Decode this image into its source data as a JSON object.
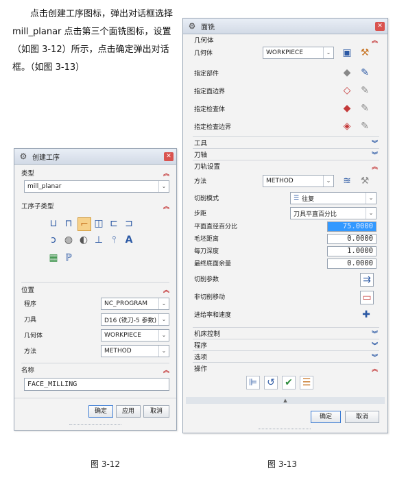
{
  "paragraph": "点击创建工序图标，弹出对话框选择 mill_planar 点击第三个面铣图标，设置（如图 3-12）所示，点击确定弹出对话框。（如图 3-13）",
  "fig12": {
    "caption": "图 3-12",
    "title": "创建工序",
    "type_section": "类型",
    "type_value": "mill_planar",
    "subtype_section": "工序子类型",
    "location_section": "位置",
    "program_label": "程序",
    "program_value": "NC_PROGRAM",
    "tool_label": "刀具",
    "tool_value": "D16 (铣刀-5 参数)",
    "geometry_label": "几何体",
    "geometry_value": "WORKPIECE",
    "method_label": "方法",
    "method_value": "METHOD",
    "name_section": "名称",
    "name_value": "FACE_MILLING",
    "ok": "确定",
    "apply": "应用",
    "cancel": "取消"
  },
  "fig13": {
    "caption": "图 3-13",
    "title": "面铣",
    "geometry_section": "几何体",
    "geometry_label": "几何体",
    "geometry_value": "WORKPIECE",
    "spec_part": "指定部件",
    "spec_face": "指定面边界",
    "spec_check": "指定检查体",
    "spec_check_boundary": "指定检查边界",
    "tool_section": "工具",
    "axis_section": "刀轴",
    "path_section": "刀轨设置",
    "method_label": "方法",
    "method_value": "METHOD",
    "cut_pattern_label": "切削模式",
    "cut_pattern_value": "往复",
    "stepover_label": "步距",
    "stepover_value": "刀具平直百分比",
    "flat_pct_label": "平面直径百分比",
    "flat_pct_value": "75.0000",
    "blank_dist_label": "毛坯距离",
    "blank_dist_value": "0.0000",
    "depth_label": "每刀深度",
    "depth_value": "1.0000",
    "floor_stock_label": "最终底面余量",
    "floor_stock_value": "0.0000",
    "cut_params": "切削参数",
    "non_cut": "非切削移动",
    "feeds": "进给率和速度",
    "machine_section": "机床控制",
    "program_section": "程序",
    "options_section": "选项",
    "ops_section": "操作",
    "ok": "确定",
    "cancel": "取消"
  }
}
